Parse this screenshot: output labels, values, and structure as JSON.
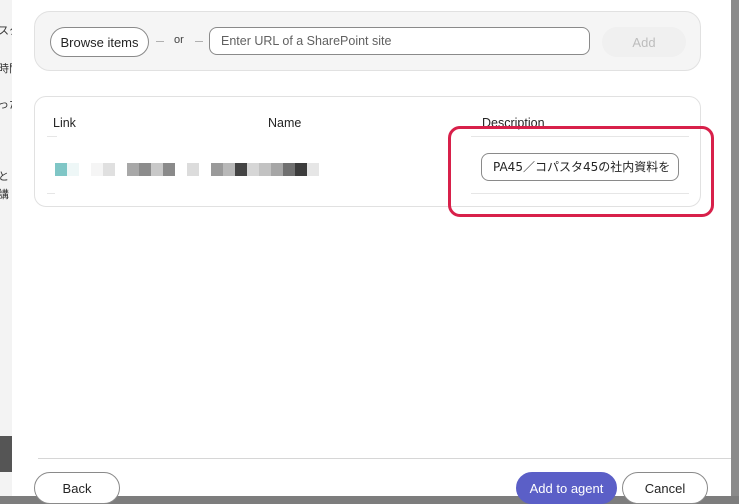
{
  "background_fragments": [
    "スタ",
    "時間",
    "った",
    "と",
    "講"
  ],
  "url_row": {
    "browse_label": "Browse items",
    "or_label": "or",
    "url_placeholder": "Enter URL of a SharePoint site",
    "url_value": "",
    "add_label": "Add"
  },
  "table": {
    "headers": {
      "link": "Link",
      "name": "Name",
      "description": "Description"
    },
    "row": {
      "link_name_redacted": true,
      "description": "PA45／コパスタ45の社内資料を"
    }
  },
  "footer": {
    "back_label": "Back",
    "add_to_agent_label": "Add to agent",
    "cancel_label": "Cancel"
  },
  "colors": {
    "primary": "#5b5fc7",
    "highlight": "#d8204a"
  }
}
